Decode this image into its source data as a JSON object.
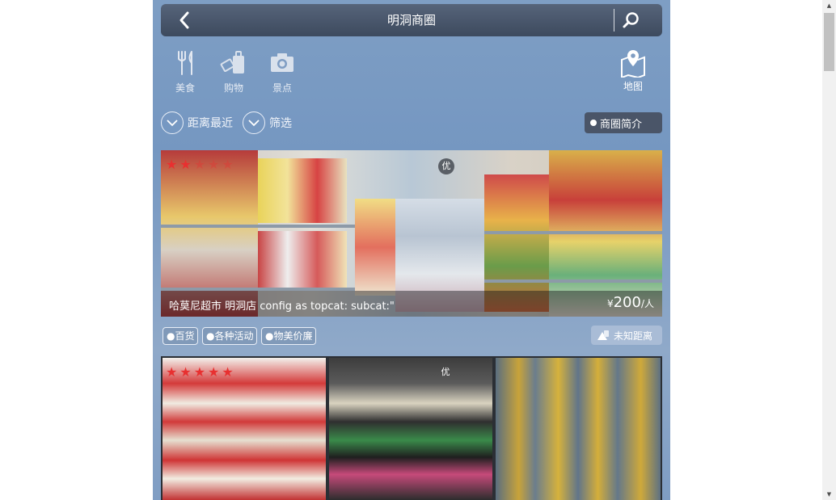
{
  "header": {
    "title": "明洞商圈",
    "back_icon": "chevron-left-icon",
    "search_icon": "search-icon"
  },
  "categories": [
    {
      "label": "美食",
      "icon": "food-icon"
    },
    {
      "label": "购物",
      "icon": "shopping-icon"
    },
    {
      "label": "景点",
      "icon": "camera-icon"
    }
  ],
  "map": {
    "label": "地图",
    "icon": "map-pin-icon"
  },
  "filters": {
    "sort_label": "距离最近",
    "filter_label": "筛选",
    "intro_label": "商圈简介"
  },
  "listing1": {
    "name": "哈莫尼超市 明洞店 config as topcat: subcat:\"",
    "currency": "¥",
    "price": "200",
    "unit": "/人",
    "badge": "优",
    "stars": 5,
    "stars_lit": 2,
    "tags": [
      "●百货",
      "●各种活动",
      "●物美价廉"
    ],
    "distance": "未知距离"
  },
  "listing2": {
    "badge": "优",
    "stars": 5,
    "stars_lit": 5
  },
  "colors": {
    "star": "#e83030",
    "topbar": "#4a5568",
    "background": "#7f9dc3"
  }
}
